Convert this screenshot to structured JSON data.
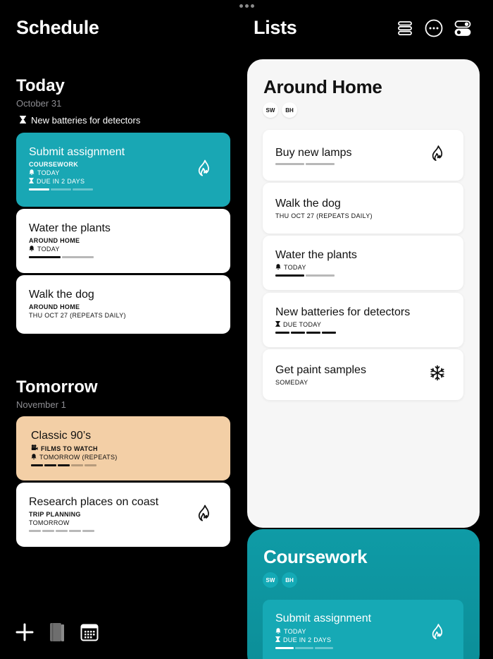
{
  "schedule": {
    "title": "Schedule",
    "today": {
      "title": "Today",
      "date": "October 31",
      "standalone": "New batteries for detectors",
      "cards": [
        {
          "title": "Submit assignment",
          "list": "COURSEWORK",
          "reminder": "TODAY",
          "due": "DUE IN 2 DAYS"
        },
        {
          "title": "Water the plants",
          "list": "AROUND HOME",
          "reminder": "TODAY"
        },
        {
          "title": "Walk the dog",
          "list": "AROUND HOME",
          "meta": "THU OCT 27 (REPEATS DAILY)"
        }
      ]
    },
    "tomorrow": {
      "title": "Tomorrow",
      "date": "November 1",
      "cards": [
        {
          "title": "Classic 90’s",
          "list": "FILMS TO WATCH",
          "reminder": "TOMORROW (REPEATS)"
        },
        {
          "title": "Research places on coast",
          "list": "TRIP PLANNING",
          "meta": "TOMORROW"
        }
      ]
    }
  },
  "lists": {
    "title": "Lists",
    "around_home": {
      "title": "Around Home",
      "avatars": [
        "SW",
        "BH"
      ],
      "items": [
        {
          "title": "Buy new lamps",
          "icon": "flame-icon"
        },
        {
          "title": "Walk the dog",
          "meta": "THU OCT 27 (REPEATS DAILY)"
        },
        {
          "title": "Water the plants",
          "meta": "TODAY"
        },
        {
          "title": "New batteries for detectors",
          "meta": "DUE TODAY"
        },
        {
          "title": "Get paint samples",
          "meta": "SOMEDAY",
          "icon": "snowflake-icon"
        }
      ]
    },
    "coursework": {
      "title": "Coursework",
      "avatars": [
        "SW",
        "BH"
      ],
      "item": {
        "title": "Submit assignment",
        "reminder": "TODAY",
        "due": "DUE IN 2 DAYS"
      }
    }
  },
  "colors": {
    "teal": "#19a7b4",
    "peach": "#f3cfa6",
    "background": "#000000"
  }
}
